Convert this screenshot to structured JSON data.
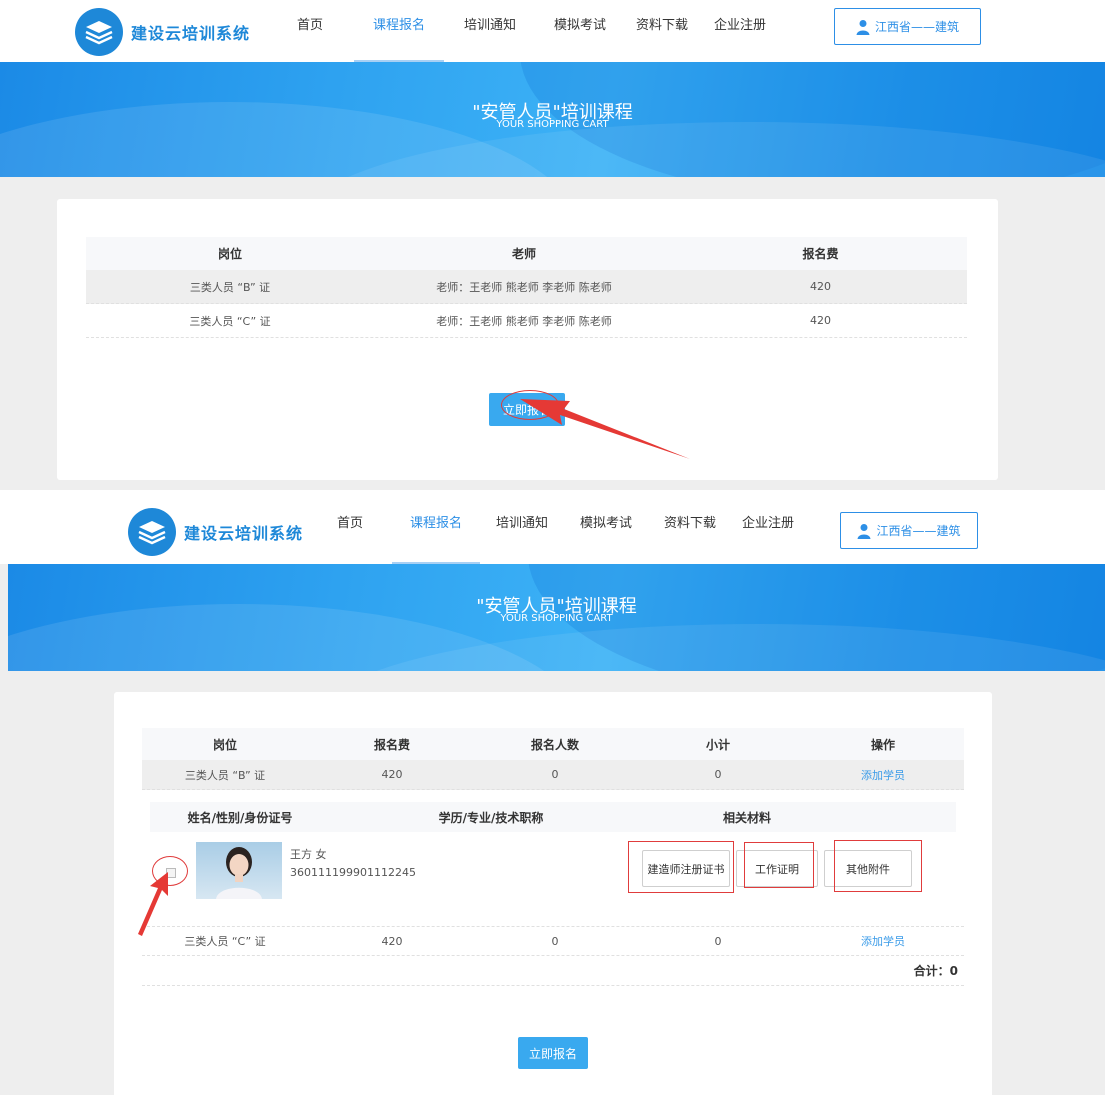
{
  "site": {
    "logo_text": "建设云培训系统",
    "nav": [
      "首页",
      "课程报名",
      "培训通知",
      "模拟考试",
      "资料下载",
      "企业注册"
    ],
    "active_nav": "课程报名",
    "region_label": "江西省——建筑"
  },
  "banner": {
    "title": "\"安管人员\"培训课程",
    "subtitle": "YOUR SHOPPING CART"
  },
  "top_table": {
    "headers": [
      "岗位",
      "老师",
      "报名费"
    ],
    "rows": [
      {
        "position": "三类人员 “B” 证",
        "teachers": "老师：王老师 熊老师 李老师 陈老师",
        "fee": "420"
      },
      {
        "position": "三类人员 “C” 证",
        "teachers": "老师：王老师 熊老师 李老师 陈老师",
        "fee": "420"
      }
    ],
    "submit_label": "立即报名"
  },
  "bottom_table": {
    "headers": [
      "岗位",
      "报名费",
      "报名人数",
      "小计",
      "操作"
    ],
    "rows": [
      {
        "position": "三类人员 “B” 证",
        "fee": "420",
        "count": "0",
        "subtotal": "0",
        "action": "添加学员"
      },
      {
        "position": "三类人员 “C” 证",
        "fee": "420",
        "count": "0",
        "subtotal": "0",
        "action": "添加学员"
      }
    ],
    "student_headers": [
      "姓名/性别/身份证号",
      "学历/专业/技术职称",
      "相关材料"
    ],
    "student": {
      "name_gender": "王方 女",
      "id_number": "360111199901112245",
      "materials": [
        "建造师注册证书",
        "工作证明",
        "其他附件"
      ]
    },
    "total_label": "合计：0",
    "submit_label": "立即报名"
  },
  "colors": {
    "brand": "#1e88d8",
    "nav_active": "#2d8fe6",
    "button": "#39a9ef",
    "annotation": "#e03c3c",
    "page_bg": "#eeeeee"
  }
}
